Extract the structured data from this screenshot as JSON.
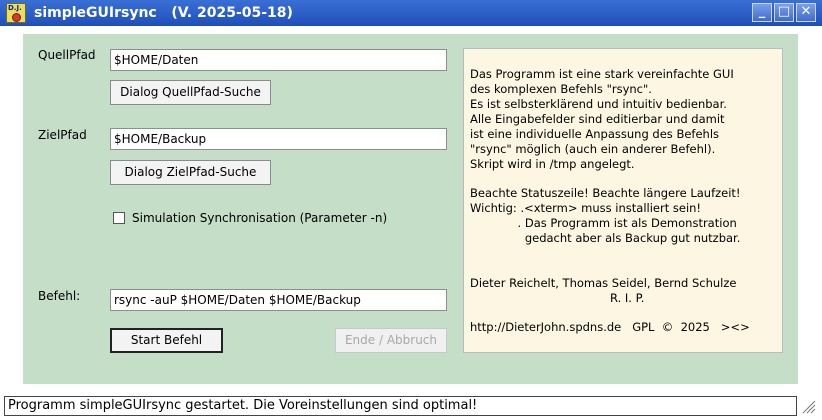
{
  "window": {
    "title": "simpleGUIrsync   (V. 2025-05-18)",
    "icon_text": "D.J.",
    "buttons": {
      "minimize": "_",
      "maximize": "□",
      "close": "✕"
    }
  },
  "form": {
    "source_label": "QuellPfad",
    "source_value": "$HOME/Daten",
    "source_dialog_button": "Dialog QuellPfad-Suche",
    "target_label": "ZielPfad",
    "target_value": "$HOME/Backup",
    "target_dialog_button": "Dialog ZielPfad-Suche",
    "simulation_label": "Simulation Synchronisation (Parameter -n)",
    "simulation_checked": false,
    "command_label": "Befehl:",
    "command_value": "rsync -auP $HOME/Daten $HOME/Backup",
    "start_button": "Start Befehl",
    "end_button": "Ende / Abbruch"
  },
  "info": {
    "lines": [
      "Das Programm ist eine stark vereinfachte GUI",
      "des komplexen Befehls \"rsync\".",
      "Es ist selbsterklärend und intuitiv bedienbar.",
      "Alle Eingabefelder sind editierbar und damit",
      "ist eine individuelle Anpassung des Befehls",
      "\"rsync\" möglich (auch ein anderer Befehl).",
      "Skript wird in /tmp angelegt.",
      "",
      "Beachte Statuszeile! Beachte längere Laufzeit!",
      "Wichtig: .<xterm> muss installiert sein!",
      "             . Das Programm ist als Demonstration",
      "               gedacht aber als Backup gut nutzbar."
    ],
    "authors": "Dieter Reichelt, Thomas Seidel, Bernd Schulze",
    "rip": "R. I. P.",
    "footer": "http://DieterJohn.spdns.de   GPL  ©  2025   ><>"
  },
  "status": {
    "text": "Programm simpleGUIrsync gestartet. Die Voreinstellungen sind optimal!"
  }
}
